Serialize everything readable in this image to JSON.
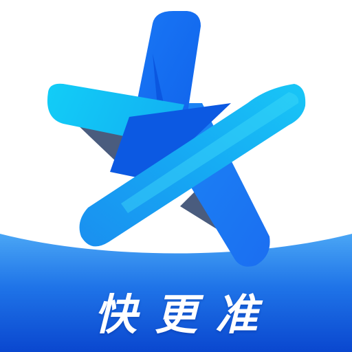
{
  "app_icon": {
    "tagline": "快更准",
    "logo_icon": "blue-star-icon",
    "colors": {
      "background": "#ffffff",
      "banner_light": "#3d9cf3",
      "banner_dark": "#0a4fd6",
      "star_blue": "#1e7cf7",
      "star_cyan": "#16c9f5",
      "star_deep": "#0b57e0",
      "star_shadow": "#4a5c7e",
      "tagline_text": "#ffffff"
    }
  }
}
